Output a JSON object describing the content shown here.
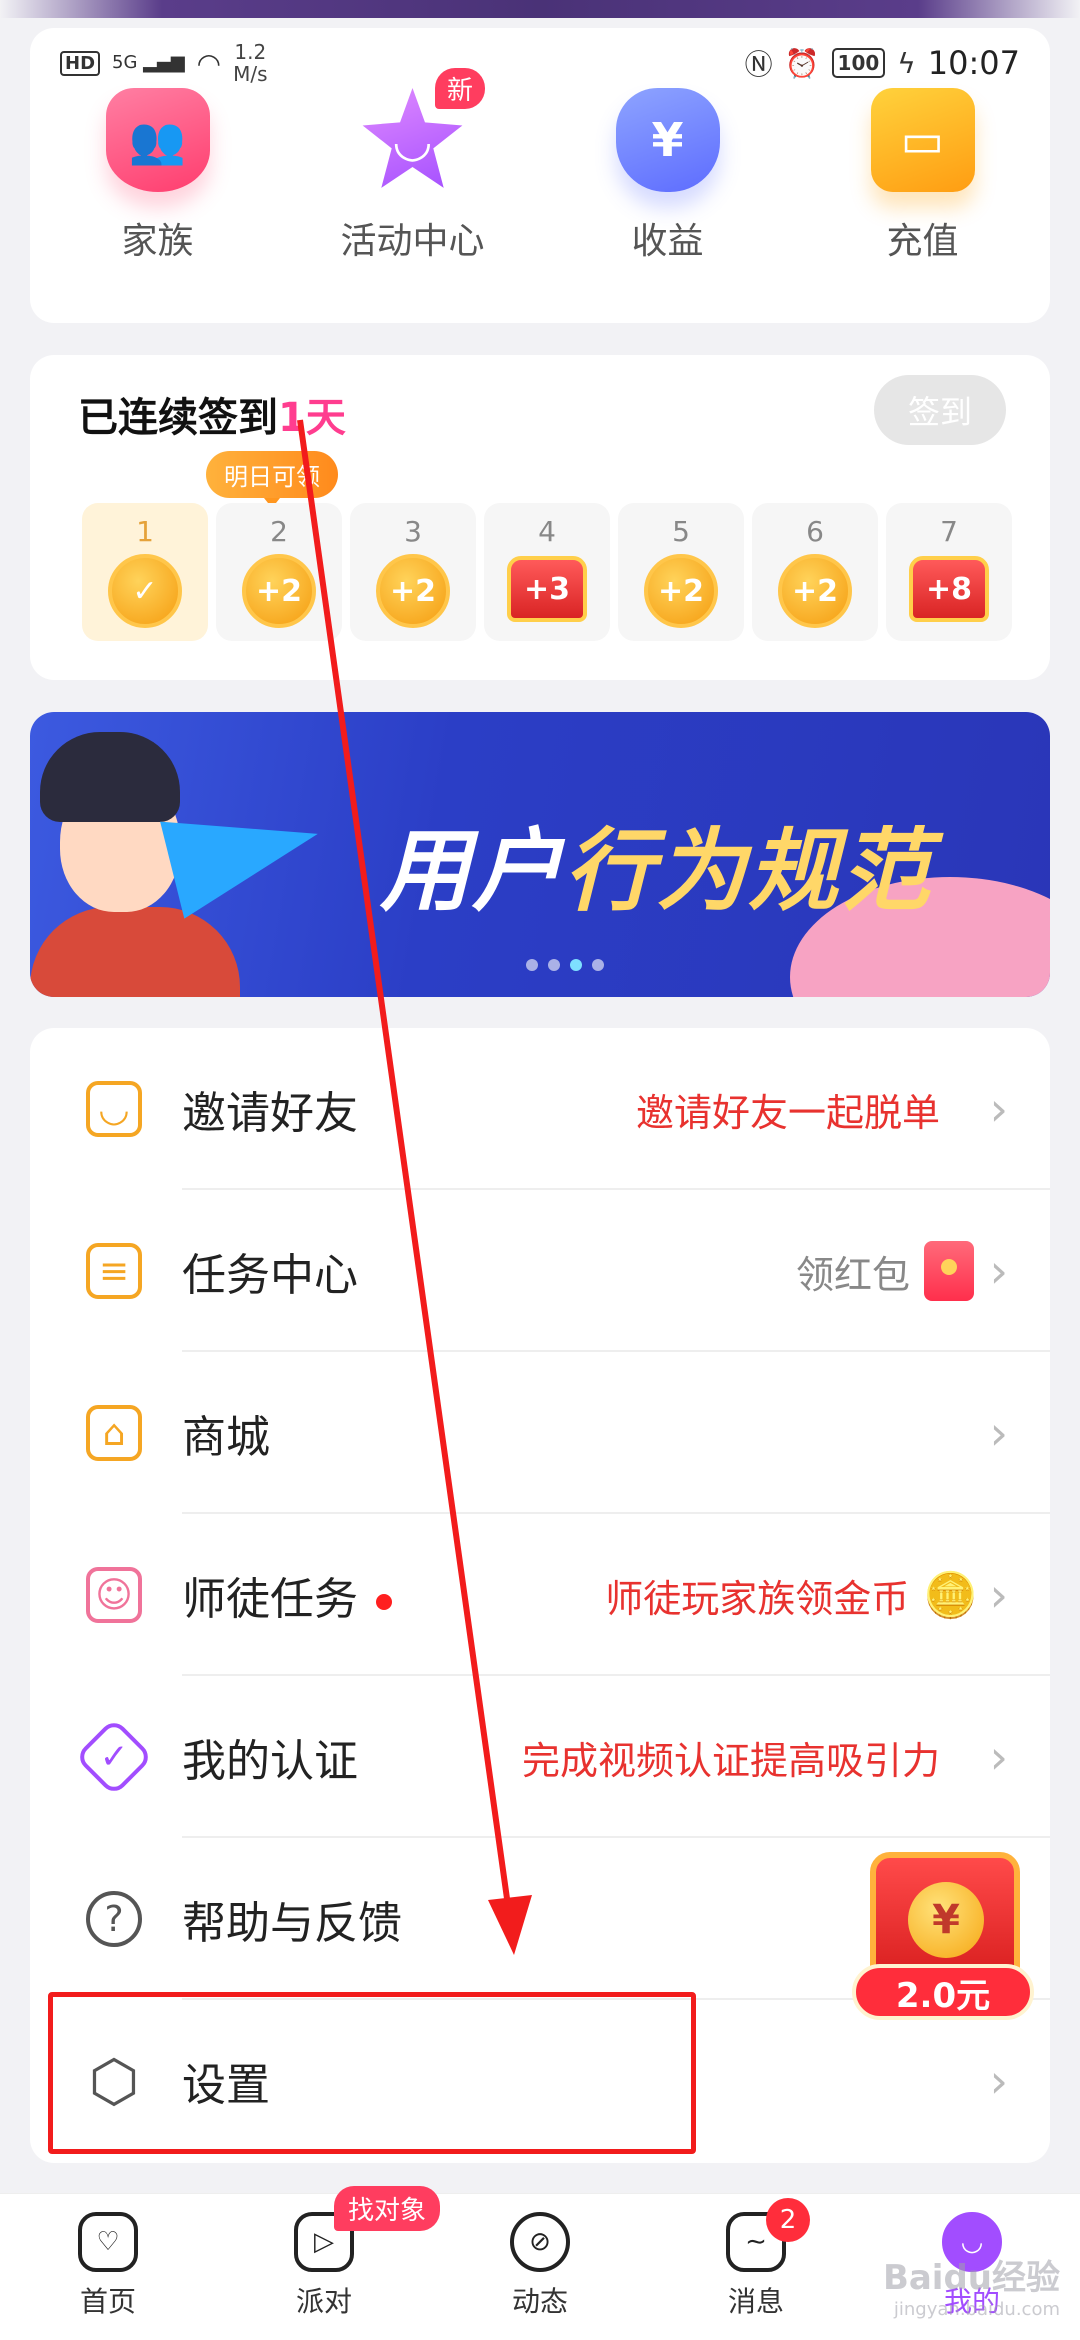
{
  "status_bar": {
    "hd": "HD",
    "network": "5G",
    "speed_value": "1.2",
    "speed_unit": "M/s",
    "battery": "100",
    "time": "10:07"
  },
  "quick_actions": [
    {
      "label": "家族",
      "icon": "family-icon"
    },
    {
      "label": "活动中心",
      "icon": "activity-star-icon",
      "badge": "新"
    },
    {
      "label": "收益",
      "icon": "money-bag-icon"
    },
    {
      "label": "充值",
      "icon": "wallet-icon"
    }
  ],
  "sign_in": {
    "title_prefix": "已连续签到",
    "streak": "1天",
    "button": "签到",
    "tomorrow_tip": "明日可领",
    "days": [
      {
        "num": "1",
        "reward": "✓",
        "kind": "coin"
      },
      {
        "num": "2",
        "reward": "+2",
        "kind": "coin"
      },
      {
        "num": "3",
        "reward": "+2",
        "kind": "coin"
      },
      {
        "num": "4",
        "reward": "+3",
        "kind": "chest"
      },
      {
        "num": "5",
        "reward": "+2",
        "kind": "coin"
      },
      {
        "num": "6",
        "reward": "+2",
        "kind": "coin"
      },
      {
        "num": "7",
        "reward": "+8",
        "kind": "chest"
      }
    ]
  },
  "banner": {
    "title_white": "用户",
    "title_yellow": "行为规范",
    "dots_count": 4,
    "active_dot": 2
  },
  "menu": [
    {
      "label": "邀请好友",
      "right": "邀请好友一起脱单",
      "icon": "invite-icon",
      "color": "#f5a623"
    },
    {
      "label": "任务中心",
      "right": "领红包",
      "icon": "task-icon",
      "color": "#f5a623"
    },
    {
      "label": "商城",
      "right": "",
      "icon": "shop-icon",
      "color": "#f5a623"
    },
    {
      "label": "师徒任务",
      "right": "师徒玩家族领金币",
      "icon": "mentor-icon",
      "color": "#f0739a"
    },
    {
      "label": "我的认证",
      "right": "完成视频认证提高吸引力",
      "icon": "verify-icon",
      "color": "#a24dff"
    },
    {
      "label": "帮助与反馈",
      "right": "",
      "icon": "help-icon",
      "color": "#555"
    },
    {
      "label": "设置",
      "right": "",
      "icon": "settings-icon",
      "color": "#555"
    }
  ],
  "floating_red_packet": {
    "coin": "¥",
    "amount": "2.0元"
  },
  "bottom_nav": [
    {
      "label": "首页",
      "icon": "home-icon"
    },
    {
      "label": "派对",
      "icon": "party-icon",
      "pill": "找对象"
    },
    {
      "label": "动态",
      "icon": "compass-icon"
    },
    {
      "label": "消息",
      "icon": "message-icon",
      "count": "2"
    },
    {
      "label": "我的",
      "icon": "profile-icon",
      "active": true
    }
  ],
  "watermark": {
    "brand": "Baidu经验",
    "url": "jingyan.baidu.com"
  },
  "colors": {
    "accent": "#a24dff",
    "highlight": "#ff3d8f",
    "annotation": "#f21c1c",
    "link_red": "#e8322f"
  }
}
